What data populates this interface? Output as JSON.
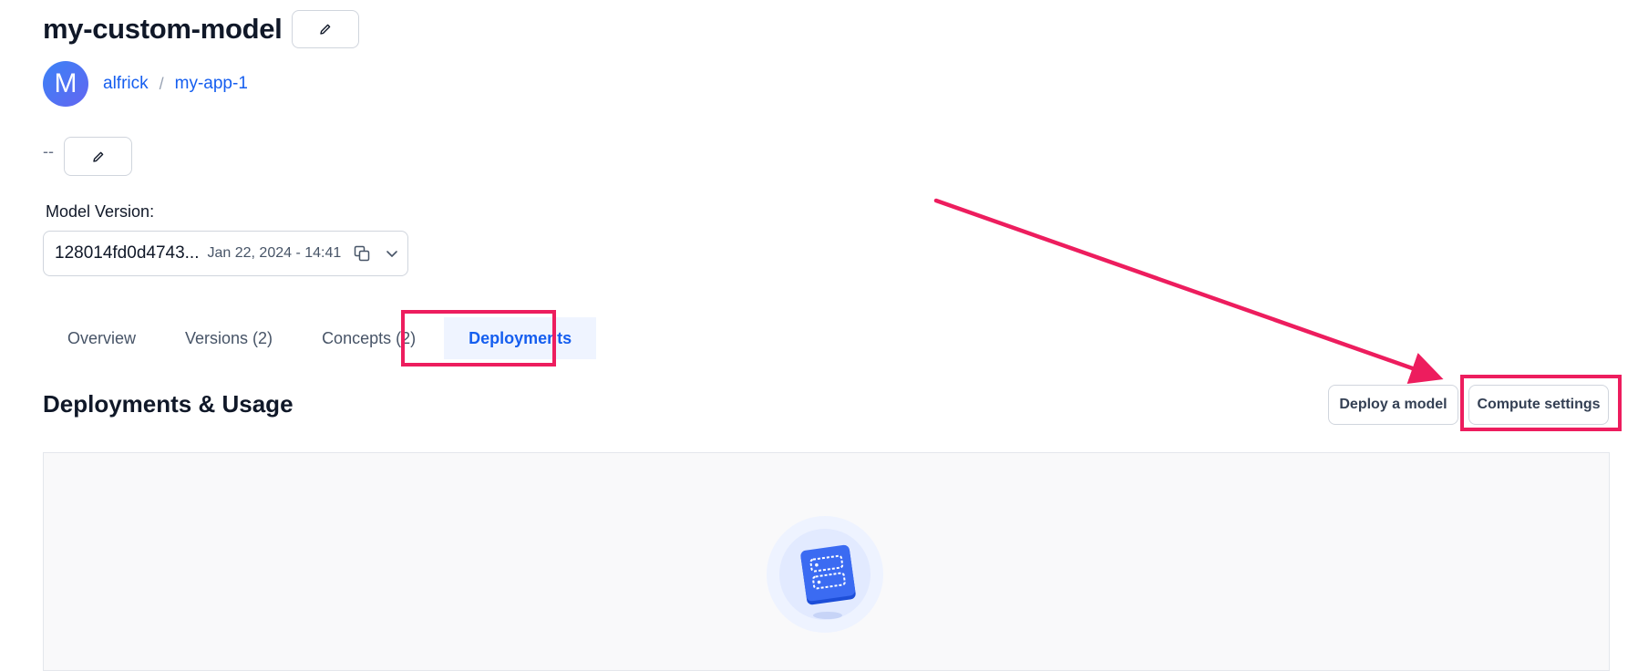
{
  "header": {
    "title": "my-custom-model"
  },
  "breadcrumb": {
    "avatar_letter": "M",
    "owner": "alfrick",
    "separator": "/",
    "app": "my-app-1"
  },
  "description": {
    "text": "--"
  },
  "model_version": {
    "label": "Model Version:",
    "id": "128014fd0d4743...",
    "date": "Jan 22, 2024 - 14:41"
  },
  "tabs": [
    {
      "label": "Overview",
      "active": false
    },
    {
      "label": "Versions (2)",
      "active": false
    },
    {
      "label": "Concepts (2)",
      "active": false
    },
    {
      "label": "Deployments",
      "active": true
    }
  ],
  "section": {
    "title": "Deployments & Usage",
    "deploy_button": "Deploy a model",
    "compute_button": "Compute settings"
  },
  "icons": {
    "title_edit": "pencil-icon",
    "description_edit": "pencil-icon",
    "copy": "copy-icon",
    "dropdown": "chevron-down-icon",
    "empty_state": "server-chip-icon"
  },
  "colors": {
    "accent": "#155eef",
    "highlight": "#ed1d5e",
    "text": "#101828",
    "muted": "#475467"
  }
}
